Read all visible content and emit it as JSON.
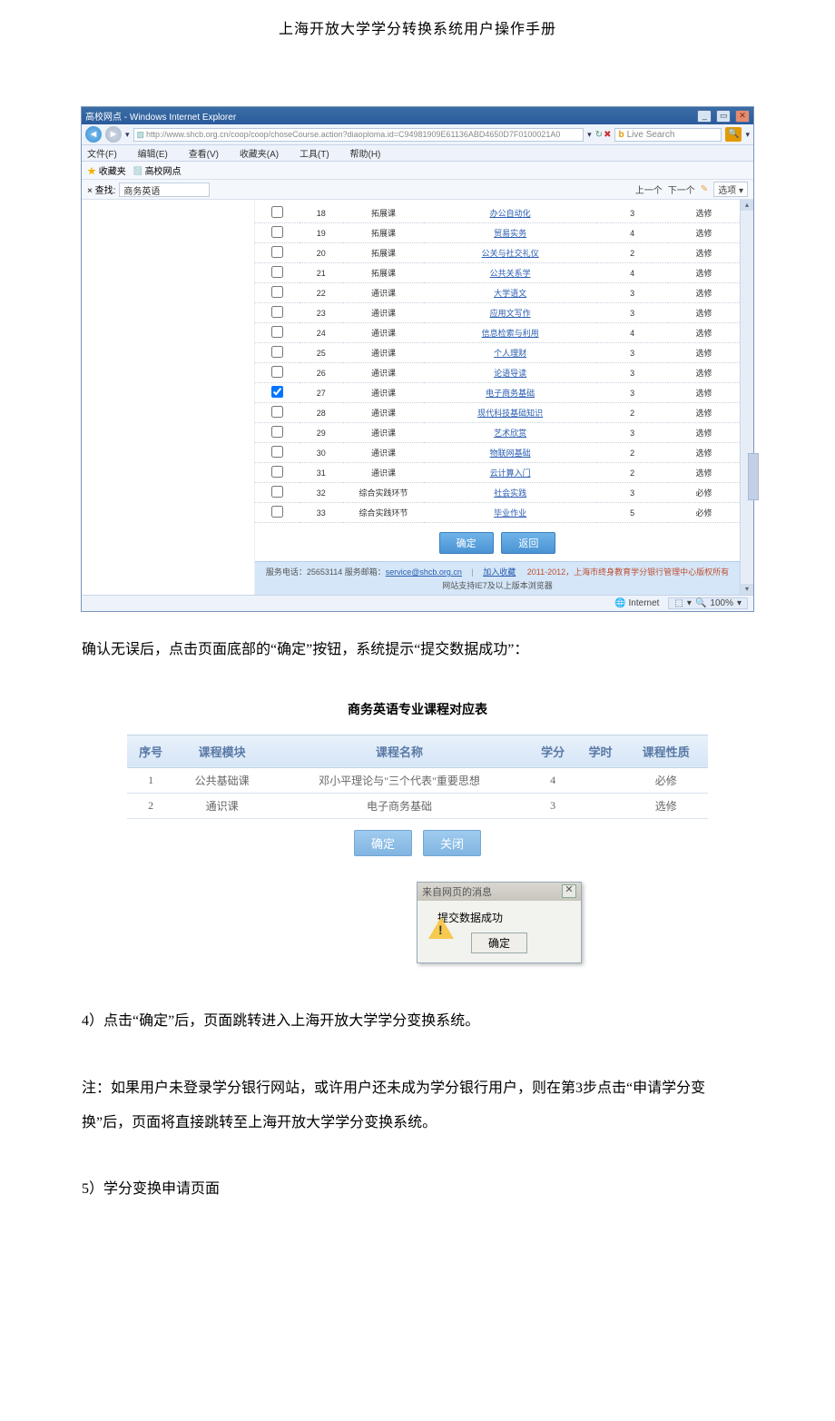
{
  "doc_title": "上海开放大学学分转换系统用户操作手册",
  "ie": {
    "window_title": "高校网点 - Windows Internet Explorer",
    "url": "http://www.shcb.org.cn/coop/coop/choseCourse.action?diaoploma.id=C94981909E61136ABD4650D7F0100021A0",
    "search_placeholder": "Live Search",
    "menu": {
      "file": "文件(F)",
      "edit": "编辑(E)",
      "view": "查看(V)",
      "fav": "收藏夹(A)",
      "tool": "工具(T)",
      "help": "帮助(H)"
    },
    "fav_label": "收藏夹",
    "fav_item": "高校网点",
    "tabbar": {
      "find_label": "× 查找:",
      "find_value": "商务英语",
      "prev": "上一个",
      "next": "下一个",
      "options": "选项 ▾"
    },
    "table_rows": [
      {
        "no": "18",
        "type": "拓展课",
        "name": "办公自动化",
        "credit": "3",
        "nature": "选修",
        "checked": false
      },
      {
        "no": "19",
        "type": "拓展课",
        "name": "贸易实务",
        "credit": "4",
        "nature": "选修",
        "checked": false
      },
      {
        "no": "20",
        "type": "拓展课",
        "name": "公关与社交礼仪",
        "credit": "2",
        "nature": "选修",
        "checked": false
      },
      {
        "no": "21",
        "type": "拓展课",
        "name": "公共关系学",
        "credit": "4",
        "nature": "选修",
        "checked": false
      },
      {
        "no": "22",
        "type": "通识课",
        "name": "大学语文",
        "credit": "3",
        "nature": "选修",
        "checked": false
      },
      {
        "no": "23",
        "type": "通识课",
        "name": "应用文写作",
        "credit": "3",
        "nature": "选修",
        "checked": false
      },
      {
        "no": "24",
        "type": "通识课",
        "name": "信息检索与利用",
        "credit": "4",
        "nature": "选修",
        "checked": false
      },
      {
        "no": "25",
        "type": "通识课",
        "name": "个人理财",
        "credit": "3",
        "nature": "选修",
        "checked": false
      },
      {
        "no": "26",
        "type": "通识课",
        "name": "论语导读",
        "credit": "3",
        "nature": "选修",
        "checked": false
      },
      {
        "no": "27",
        "type": "通识课",
        "name": "电子商务基础",
        "credit": "3",
        "nature": "选修",
        "checked": true
      },
      {
        "no": "28",
        "type": "通识课",
        "name": "现代科技基础知识",
        "credit": "2",
        "nature": "选修",
        "checked": false
      },
      {
        "no": "29",
        "type": "通识课",
        "name": "艺术欣赏",
        "credit": "3",
        "nature": "选修",
        "checked": false
      },
      {
        "no": "30",
        "type": "通识课",
        "name": "物联网基础",
        "credit": "2",
        "nature": "选修",
        "checked": false
      },
      {
        "no": "31",
        "type": "通识课",
        "name": "云计算入门",
        "credit": "2",
        "nature": "选修",
        "checked": false
      },
      {
        "no": "32",
        "type": "综合实践环节",
        "name": "社会实践",
        "credit": "3",
        "nature": "必修",
        "checked": false
      },
      {
        "no": "33",
        "type": "综合实践环节",
        "name": "毕业作业",
        "credit": "5",
        "nature": "必修",
        "checked": false
      }
    ],
    "btn_ok": "确定",
    "btn_back": "返回",
    "footer": {
      "line1_left": "服务电话：25653114 服务邮箱：",
      "mail": "service@shcb.org.cn",
      "favlink": "加入收藏",
      "copyright": "2011-2012，上海市终身教育学分银行管理中心版权所有",
      "line2": "网站支持IE7及以上版本浏览器"
    },
    "status": {
      "internet": "Internet",
      "zoom": "100%"
    }
  },
  "para_after_shot": "确认无误后，点击页面底部的“确定”按钮，系统提示“提交数据成功”：",
  "table2": {
    "title": "商务英语专业课程对应表",
    "headers": {
      "no": "序号",
      "module": "课程模块",
      "name": "课程名称",
      "credit": "学分",
      "hour": "学时",
      "nature": "课程性质"
    },
    "rows": [
      {
        "no": "1",
        "module": "公共基础课",
        "name": "邓小平理论与\"三个代表\"重要思想",
        "credit": "4",
        "hour": "",
        "nature": "必修"
      },
      {
        "no": "2",
        "module": "通识课",
        "name": "电子商务基础",
        "credit": "3",
        "hour": "",
        "nature": "选修"
      }
    ],
    "btn_ok": "确定",
    "btn_close": "关闭"
  },
  "alert": {
    "title": "来自网页的消息",
    "text": "提交数据成功",
    "ok": "确定"
  },
  "para4": "4）点击“确定”后，页面跳转进入上海开放大学学分变换系统。",
  "para_note": "注：如果用户未登录学分银行网站，或许用户还未成为学分银行用户，则在第3步点击“申请学分变换”后，页面将直接跳转至上海开放大学学分变换系统。",
  "para5": "5）学分变换申请页面"
}
